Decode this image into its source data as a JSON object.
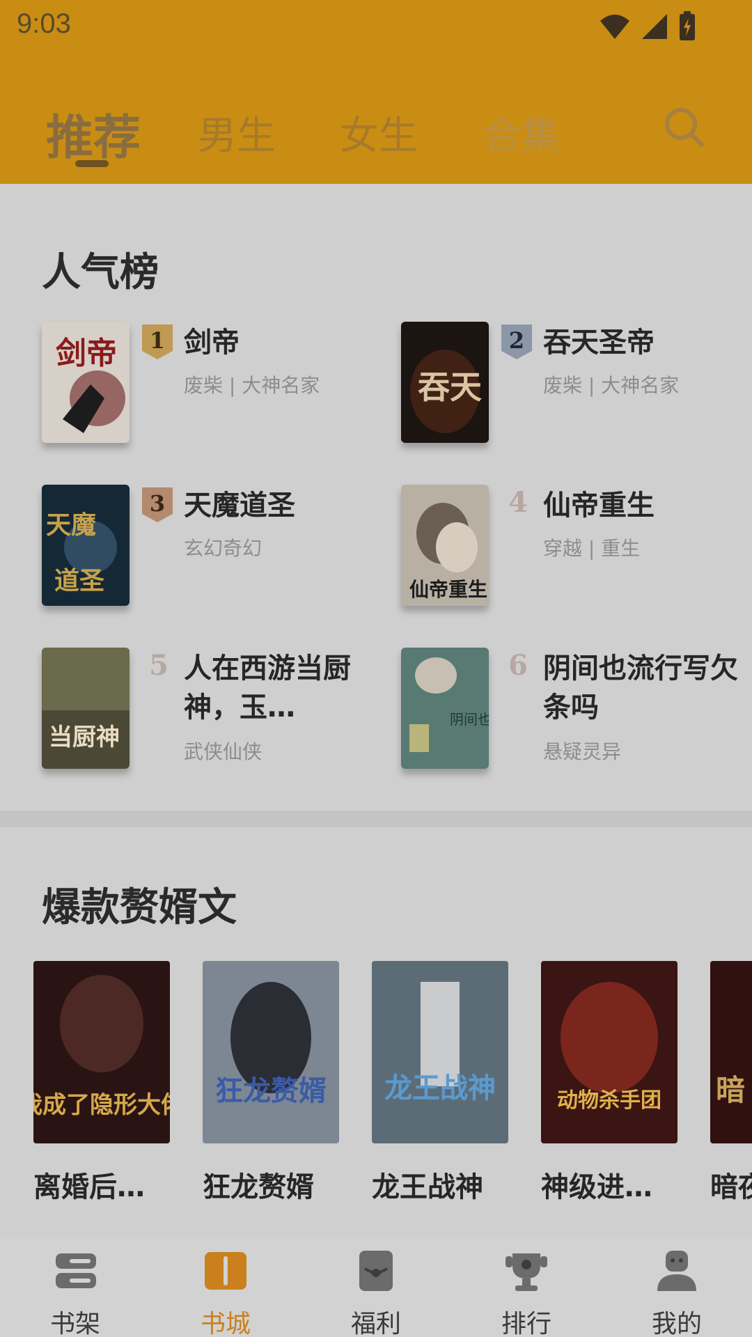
{
  "status_bar": {
    "time": "9:03"
  },
  "tabs": [
    {
      "label": "推荐",
      "active": true
    },
    {
      "label": "男生",
      "active": false
    },
    {
      "label": "女生",
      "active": false
    },
    {
      "label": "合集",
      "active": false
    }
  ],
  "popular": {
    "title": "人气榜",
    "items": [
      {
        "rank": "1",
        "title": "剑帝",
        "subtitle": "废柴 | 大神名家"
      },
      {
        "rank": "2",
        "title": "吞天圣帝",
        "subtitle": "废柴 | 大神名家"
      },
      {
        "rank": "3",
        "title": "天魔道圣",
        "subtitle": "玄幻奇幻"
      },
      {
        "rank": "4",
        "title": "仙帝重生",
        "subtitle": "穿越 | 重生"
      },
      {
        "rank": "5",
        "title": "人在西游当厨神，玉…",
        "subtitle": "武侠仙侠"
      },
      {
        "rank": "6",
        "title": "阴间也流行写欠条吗",
        "subtitle": "悬疑灵异"
      }
    ]
  },
  "explosive": {
    "title": "爆款赘婿文",
    "books": [
      {
        "title": "离婚后…",
        "cover_text": "我成了隐形大佬"
      },
      {
        "title": "狂龙赘婿",
        "cover_text": "狂龙赘婿"
      },
      {
        "title": "龙王战神",
        "cover_text": "龙王战神"
      },
      {
        "title": "神级进…",
        "cover_text": "动物杀手团"
      },
      {
        "title": "暗夜",
        "cover_text": "暗"
      }
    ]
  },
  "bottom_nav": [
    {
      "label": "书架",
      "active": false
    },
    {
      "label": "书城",
      "active": true
    },
    {
      "label": "福利",
      "active": false
    },
    {
      "label": "排行",
      "active": false
    },
    {
      "label": "我的",
      "active": false
    }
  ],
  "colors": {
    "header_bg": "#c98d14",
    "accent": "#c9801d",
    "content_bg": "#cfcfcf"
  }
}
